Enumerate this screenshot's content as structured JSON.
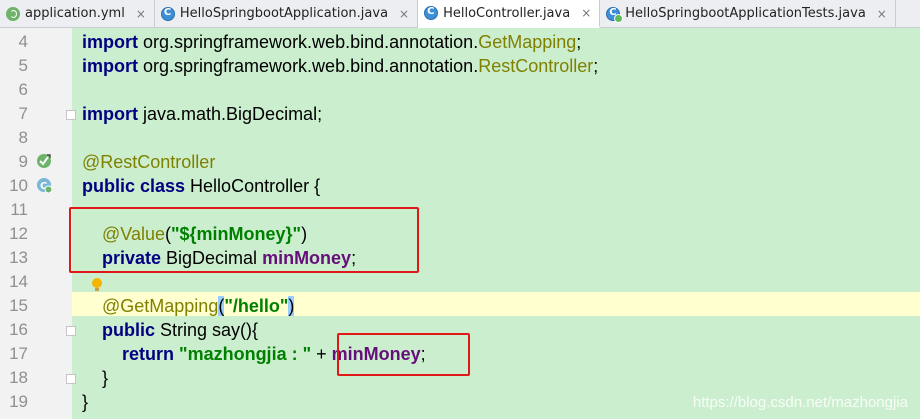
{
  "tabs": [
    {
      "label": "application.yml",
      "icon": "yaml-file-icon",
      "active": false
    },
    {
      "label": "HelloSpringbootApplication.java",
      "icon": "java-class-icon",
      "active": false
    },
    {
      "label": "HelloController.java",
      "icon": "java-class-icon",
      "active": true
    },
    {
      "label": "HelloSpringbootApplicationTests.java",
      "icon": "java-test-class-icon",
      "active": false
    }
  ],
  "close_glyph": "×",
  "line_numbers": [
    "4",
    "5",
    "6",
    "7",
    "8",
    "9",
    "10",
    "11",
    "12",
    "13",
    "14",
    "15",
    "16",
    "17",
    "18",
    "19"
  ],
  "code": {
    "l4": {
      "kw": "import",
      "pkg": " org.springframework.web.bind.annotation.",
      "cls": "GetMapping",
      "end": ";"
    },
    "l5": {
      "kw": "import",
      "pkg": " org.springframework.web.bind.annotation.",
      "cls": "RestController",
      "end": ";"
    },
    "l7": {
      "kw": "import",
      "rest": " java.math.BigDecimal;"
    },
    "l9": {
      "anno": "@RestController"
    },
    "l10": {
      "kw": "public class",
      "rest": " HelloController {"
    },
    "l12": {
      "anno": "@Value",
      "open": "(",
      "str": "\"${minMoney}\"",
      "close": ")"
    },
    "l13": {
      "kw": "private",
      "type": " BigDecimal ",
      "field": "minMoney",
      "end": ";"
    },
    "l15": {
      "anno": "@GetMapping",
      "open": "(",
      "str": "\"/hello\"",
      "close": ")"
    },
    "l16": {
      "kw": "public",
      "rest": " String say(){"
    },
    "l17": {
      "kw": "return",
      "sp": " ",
      "str": "\"mazhongjia : \"",
      "plus": " + ",
      "field": "minMoney",
      "end": ";"
    },
    "l18": {
      "rest": "}"
    },
    "l19": {
      "rest": "}"
    }
  },
  "watermark": "https://blog.csdn.net/mazhongjia",
  "colors": {
    "editor_bg": "#cbeecf",
    "caret_line": "#ffffd0",
    "highlight_box": "#e01818"
  }
}
